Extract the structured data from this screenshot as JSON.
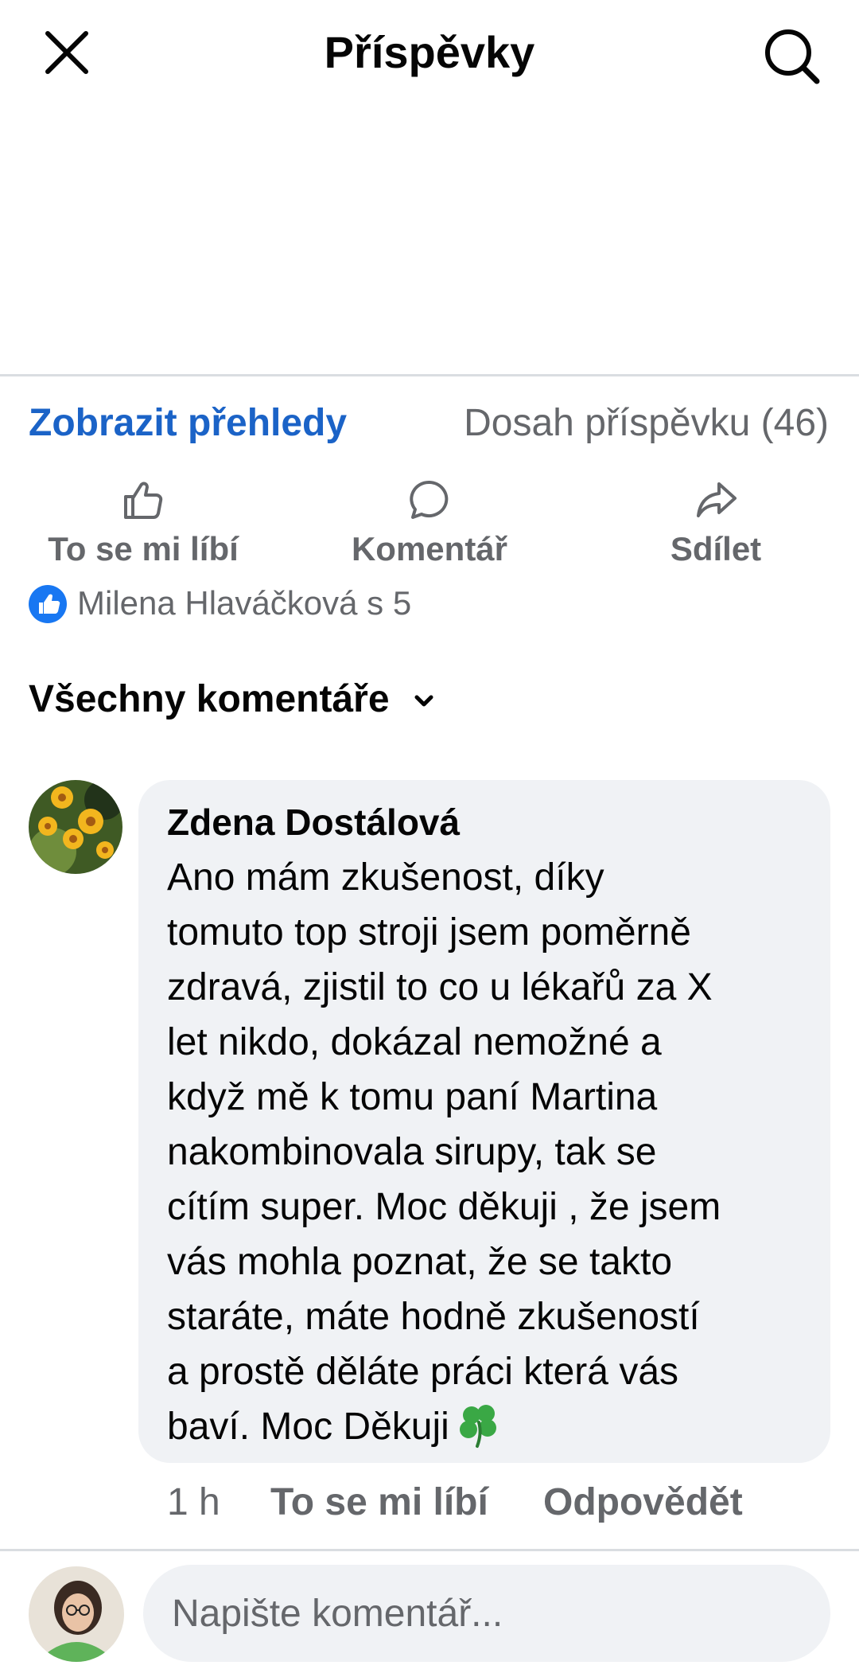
{
  "header": {
    "title": "Příspěvky",
    "close_icon": "close-icon",
    "search_icon": "search-icon"
  },
  "post_footer": {
    "insights_link": "Zobrazit přehledy",
    "reach": "Dosah příspěvku (46)"
  },
  "actions": {
    "like": "To se mi líbí",
    "comment": "Komentář",
    "share": "Sdílet"
  },
  "reactions": {
    "summary": "Milena Hlaváčková s 5"
  },
  "comments_filter": {
    "label": "Všechny komentáře"
  },
  "comment": {
    "author": "Zdena Dostálová",
    "text_lines": [
      "Ano mám zkušenost, díky",
      "tomuto top stroji jsem poměrně",
      "zdravá, zjistil to co u lékařů za X",
      "let nikdo, dokázal nemožné a",
      "když mě k tomu paní Martina",
      "nakombinovala sirupy, tak se",
      "cítím super. Moc děkuji , že jsem",
      "vás mohla poznat, že se takto",
      "staráte, máte hodně zkušeností",
      "a prostě děláte práci která vás",
      "baví. Moc Děkuji"
    ],
    "time": "1 h",
    "like_label": "To se mi líbí",
    "reply_label": "Odpovědět"
  },
  "composer": {
    "placeholder": "Napište komentář..."
  },
  "colors": {
    "link_blue": "#1b63c7",
    "like_blue": "#1877f2",
    "secondary_text": "#65676b",
    "bubble_bg": "#f0f2f5"
  }
}
